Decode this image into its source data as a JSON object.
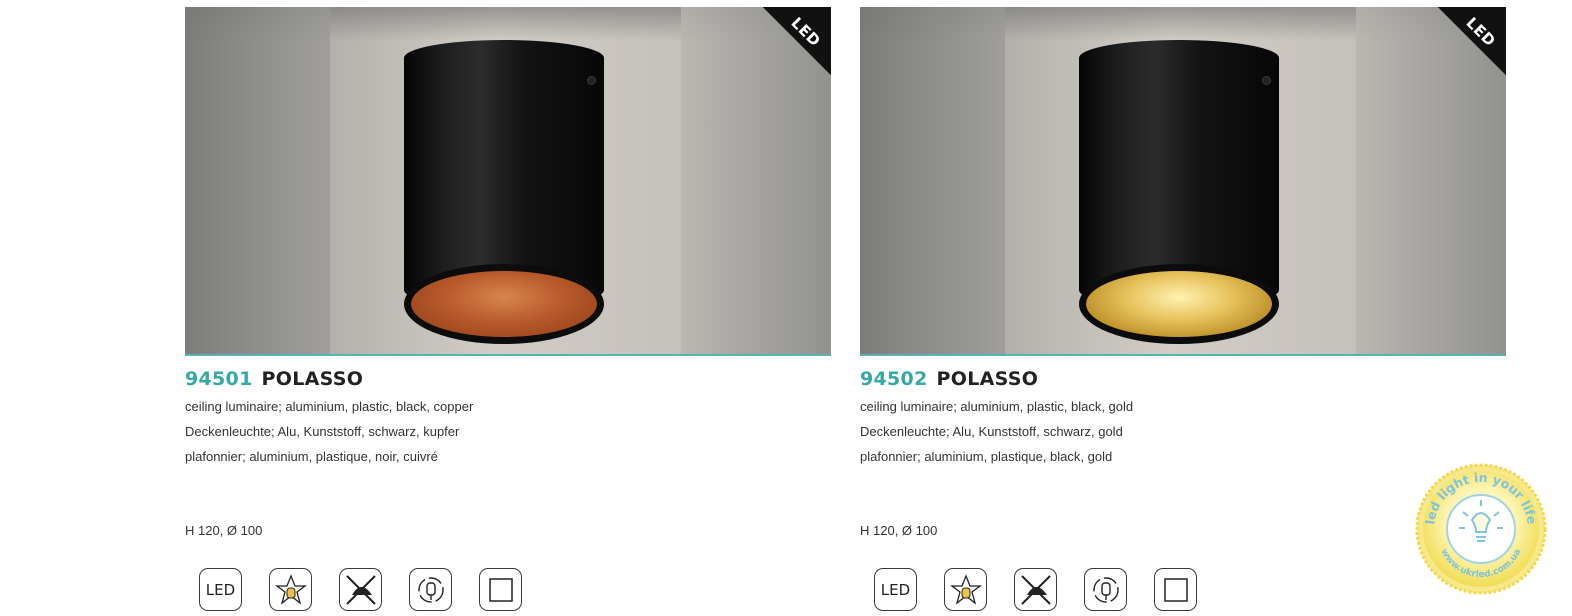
{
  "products": [
    {
      "code": "94501",
      "name": "POLASSO",
      "badge": "LED",
      "desc_en": "ceiling luminaire; aluminium, plastic, black, copper",
      "desc_de": "Deckenleuchte; Alu, Kunststoff, schwarz, kupfer",
      "desc_fr": "plafonnier; aluminium, plastique, noir, cuivré",
      "dimensions": "H 120, Ø 100",
      "inner_color": "#b85a2a",
      "icons": [
        {
          "name": "led-icon",
          "text": "LED"
        },
        {
          "name": "protection-class-icon"
        },
        {
          "name": "not-dimmable-icon"
        },
        {
          "name": "rotatable-icon"
        },
        {
          "name": "class-ii-icon"
        }
      ]
    },
    {
      "code": "94502",
      "name": "POLASSO",
      "badge": "LED",
      "desc_en": "ceiling luminaire; aluminium, plastic, black, gold",
      "desc_de": "Deckenleuchte; Alu, Kunststoff, schwarz, gold",
      "desc_fr": "plafonnier; aluminium, plastique, black, gold",
      "dimensions": "H 120, Ø 100",
      "inner_color": "#e7c25c",
      "icons": [
        {
          "name": "led-icon",
          "text": "LED"
        },
        {
          "name": "protection-class-icon"
        },
        {
          "name": "not-dimmable-icon"
        },
        {
          "name": "rotatable-icon"
        },
        {
          "name": "class-ii-icon"
        }
      ]
    }
  ],
  "watermark": {
    "text_top": "led light in your life",
    "text_bottom": "www.ukrled.com.ua",
    "color": "#f2e05a"
  },
  "accent_color": "#35a9a4"
}
